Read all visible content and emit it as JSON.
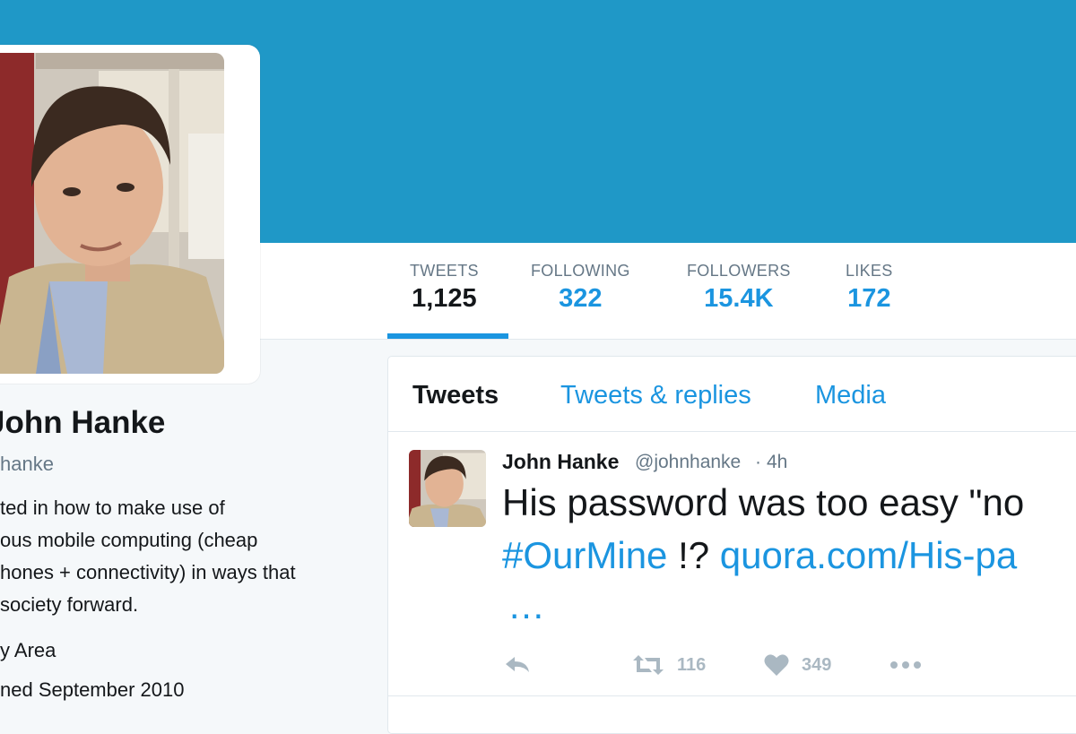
{
  "colors": {
    "banner": "#1f98c7",
    "accent": "#1b95e0",
    "muted": "#657786",
    "icon": "#aab8c2"
  },
  "stats": [
    {
      "label": "TWEETS",
      "value": "1,125",
      "active": true
    },
    {
      "label": "FOLLOWING",
      "value": "322"
    },
    {
      "label": "FOLLOWERS",
      "value": "15.4K"
    },
    {
      "label": "LIKES",
      "value": "172"
    }
  ],
  "profile": {
    "name": "John Hanke",
    "handle": "hanke",
    "bio_lines": [
      "ted in how to make use of",
      "ous mobile computing (cheap",
      "hones + connectivity) in ways that",
      "society forward."
    ],
    "location": "y Area",
    "joined": "ned September 2010"
  },
  "tabs": [
    {
      "label": "Tweets",
      "active": true
    },
    {
      "label": "Tweets & replies"
    },
    {
      "label": "Media"
    }
  ],
  "tweet": {
    "author": "John Hanke",
    "handle": "@johnhanke",
    "separator": "·",
    "time": "4h",
    "text_line1": "His password was too easy \"no",
    "hashtag": "#OurMine",
    "punct": " !? ",
    "link": "quora.com/His-pa",
    "ellipsis": "…",
    "retweets": "116",
    "likes": "349",
    "icons": {
      "reply": "reply-icon",
      "retweet": "retweet-icon",
      "like": "heart-icon",
      "more": "more-icon"
    }
  }
}
